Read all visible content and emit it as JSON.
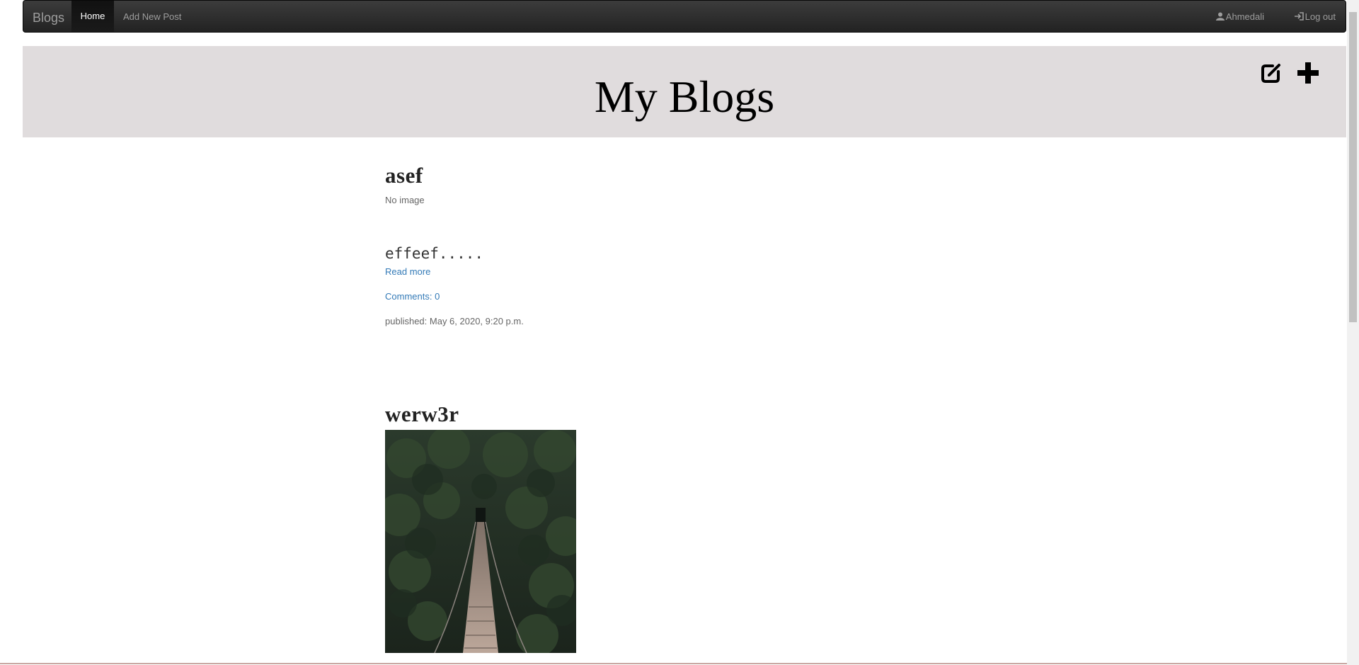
{
  "navbar": {
    "brand": "Blogs",
    "home_label": "Home",
    "add_post_label": "Add New Post",
    "user_label": "Ahmedali",
    "logout_label": "Log out"
  },
  "header": {
    "title": "My Blogs",
    "icons": [
      "edit-icon",
      "plus-icon"
    ]
  },
  "posts": [
    {
      "title": "asef",
      "image_text": "No image",
      "excerpt": "effeef.....",
      "read_more": "Read more",
      "comments": "Comments: 0",
      "published": "published: May 6, 2020, 9:20 p.m."
    },
    {
      "title": "werw3r",
      "image_alt": "forest suspension bridge"
    }
  ],
  "colors": {
    "navbar": "#222222",
    "jumbotron": "#e0dcdd",
    "link": "#337ab7"
  }
}
